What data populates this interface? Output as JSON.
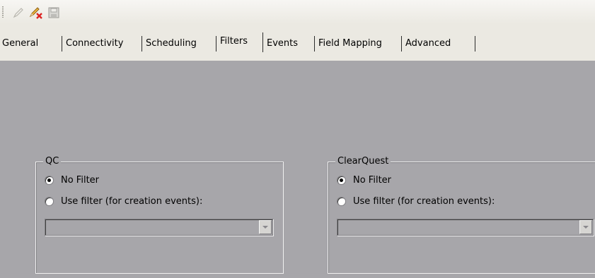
{
  "toolbar": {
    "buttons": [
      {
        "icon": "pencil-icon",
        "enabled": false
      },
      {
        "icon": "pencil-delete-icon",
        "enabled": true
      },
      {
        "icon": "save-icon",
        "enabled": false
      }
    ]
  },
  "tabs": [
    {
      "label": "General"
    },
    {
      "label": "Connectivity"
    },
    {
      "label": "Scheduling"
    },
    {
      "label": "Filters",
      "active": true
    },
    {
      "label": "Events"
    },
    {
      "label": "Field Mapping"
    },
    {
      "label": "Advanced"
    }
  ],
  "groups": {
    "qc": {
      "title": "QC",
      "option_no_filter": "No Filter",
      "option_use_filter": "Use filter (for creation events):",
      "selected": "no_filter",
      "filter_value": ""
    },
    "clearquest": {
      "title": "ClearQuest",
      "option_no_filter": "No Filter",
      "option_use_filter": "Use filter (for creation events):",
      "selected": "no_filter",
      "filter_value": ""
    }
  },
  "colors": {
    "panel_bg": "#a7a6aa",
    "toolbar_bg": "#ebe9e2"
  }
}
